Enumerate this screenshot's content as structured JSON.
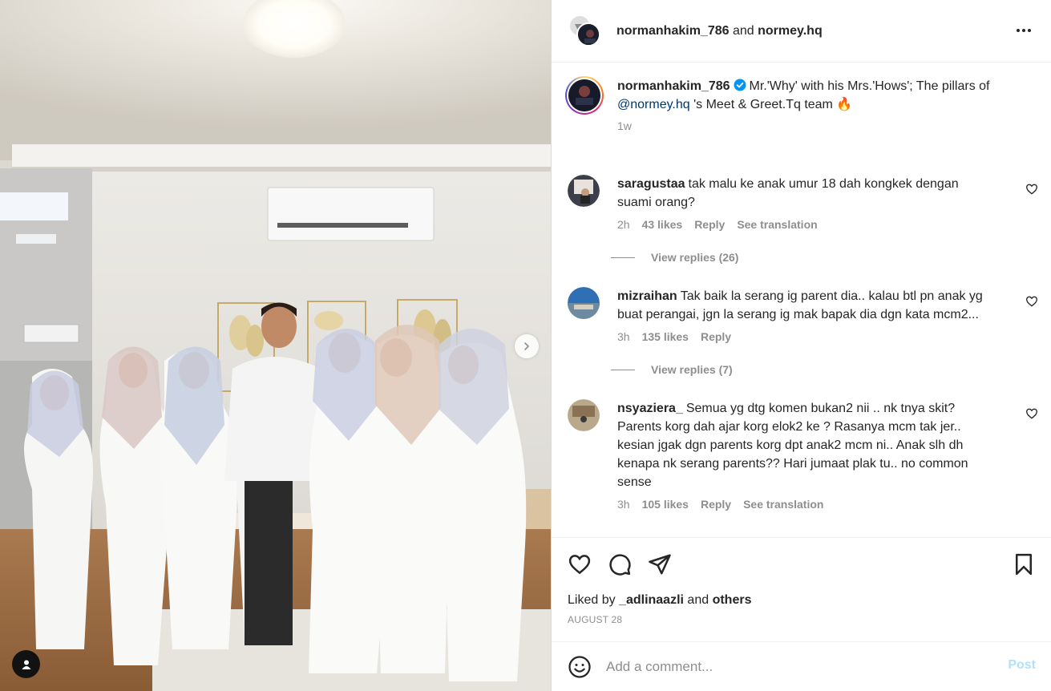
{
  "header": {
    "user1": "normanhakim_786",
    "joiner": "and",
    "user2": "normey.hq",
    "more_icon": "more-horizontal-icon"
  },
  "caption": {
    "username": "normanhakim_786",
    "text_before": "Mr.'Why' with his Mrs.'Hows'; The pillars of ",
    "mention": "@normey.hq",
    "text_after": " 's Meet & Greet.Tq team 🔥",
    "time": "1w"
  },
  "comments": [
    {
      "username": "saragustaa",
      "text": "tak malu ke anak umur 18 dah kongkek dengan suami orang?",
      "time": "2h",
      "likes": "43 likes",
      "reply": "Reply",
      "translate": "See translation",
      "view_replies": "View replies (26)"
    },
    {
      "username": "mizraihan",
      "text": "Tak baik la serang ig parent dia.. kalau btl pn anak yg buat perangai, jgn la serang ig mak bapak dia dgn kata mcm2...",
      "time": "3h",
      "likes": "135 likes",
      "reply": "Reply",
      "view_replies": "View replies (7)"
    },
    {
      "username": "nsyaziera_",
      "text": "Semua yg dtg komen bukan2 nii .. nk tnya skit? Parents korg dah ajar korg elok2 ke ? Rasanya mcm tak jer.. kesian jgak dgn parents korg dpt anak2 mcm ni.. Anak slh dh kenapa nk serang parents?? Hari jumaat plak tu.. no common sense",
      "time": "3h",
      "likes": "105 likes",
      "reply": "Reply",
      "translate": "See translation"
    }
  ],
  "actions": {
    "like_icon": "heart-icon",
    "comment_icon": "comment-icon",
    "share_icon": "send-icon",
    "save_icon": "bookmark-icon"
  },
  "likes": {
    "prefix": "Liked by ",
    "user": "_adlinaazli",
    "joiner": " and ",
    "others": "others"
  },
  "date": "AUGUST 28",
  "composer": {
    "placeholder": "Add a comment...",
    "post": "Post"
  },
  "colors": {
    "text": "#262626",
    "secondary": "#8e8e8e",
    "link": "#00376b",
    "post_disabled": "#b2dffc",
    "verified": "#0095f6"
  }
}
